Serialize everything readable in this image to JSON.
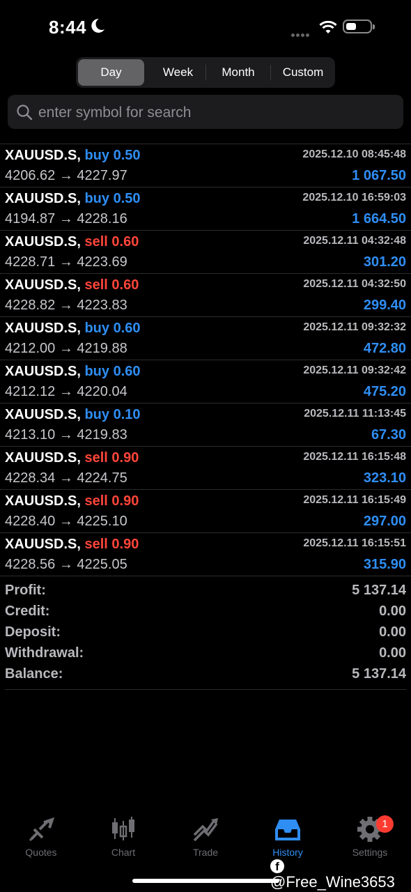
{
  "status": {
    "time": "8:44"
  },
  "period_tabs": [
    {
      "label": "Day",
      "active": true
    },
    {
      "label": "Week",
      "active": false
    },
    {
      "label": "Month",
      "active": false
    },
    {
      "label": "Custom",
      "active": false
    }
  ],
  "search": {
    "placeholder": "enter symbol for search",
    "value": ""
  },
  "deals": [
    {
      "symbol": "XAUUSD.S,",
      "side": "buy",
      "volume": "0.50",
      "datetime": "2025.12.10 08:45:48",
      "open": "4206.62",
      "close": "4227.97",
      "profit": "1 067.50"
    },
    {
      "symbol": "XAUUSD.S,",
      "side": "buy",
      "volume": "0.50",
      "datetime": "2025.12.10 16:59:03",
      "open": "4194.87",
      "close": "4228.16",
      "profit": "1 664.50"
    },
    {
      "symbol": "XAUUSD.S,",
      "side": "sell",
      "volume": "0.60",
      "datetime": "2025.12.11 04:32:48",
      "open": "4228.71",
      "close": "4223.69",
      "profit": "301.20"
    },
    {
      "symbol": "XAUUSD.S,",
      "side": "sell",
      "volume": "0.60",
      "datetime": "2025.12.11 04:32:50",
      "open": "4228.82",
      "close": "4223.83",
      "profit": "299.40"
    },
    {
      "symbol": "XAUUSD.S,",
      "side": "buy",
      "volume": "0.60",
      "datetime": "2025.12.11 09:32:32",
      "open": "4212.00",
      "close": "4219.88",
      "profit": "472.80"
    },
    {
      "symbol": "XAUUSD.S,",
      "side": "buy",
      "volume": "0.60",
      "datetime": "2025.12.11 09:32:42",
      "open": "4212.12",
      "close": "4220.04",
      "profit": "475.20"
    },
    {
      "symbol": "XAUUSD.S,",
      "side": "buy",
      "volume": "0.10",
      "datetime": "2025.12.11 11:13:45",
      "open": "4213.10",
      "close": "4219.83",
      "profit": "67.30"
    },
    {
      "symbol": "XAUUSD.S,",
      "side": "sell",
      "volume": "0.90",
      "datetime": "2025.12.11 16:15:48",
      "open": "4228.34",
      "close": "4224.75",
      "profit": "323.10"
    },
    {
      "symbol": "XAUUSD.S,",
      "side": "sell",
      "volume": "0.90",
      "datetime": "2025.12.11 16:15:49",
      "open": "4228.40",
      "close": "4225.10",
      "profit": "297.00"
    },
    {
      "symbol": "XAUUSD.S,",
      "side": "sell",
      "volume": "0.90",
      "datetime": "2025.12.11 16:15:51",
      "open": "4228.56",
      "close": "4225.05",
      "profit": "315.90"
    }
  ],
  "arrow": "→",
  "summary": [
    {
      "label": "Profit:",
      "value": "5 137.14"
    },
    {
      "label": "Credit:",
      "value": "0.00"
    },
    {
      "label": "Deposit:",
      "value": "0.00"
    },
    {
      "label": "Withdrawal:",
      "value": "0.00"
    },
    {
      "label": "Balance:",
      "value": "5 137.14"
    }
  ],
  "tabbar": [
    {
      "label": "Quotes",
      "icon": "quotes-icon",
      "active": false
    },
    {
      "label": "Chart",
      "icon": "chart-icon",
      "active": false
    },
    {
      "label": "Trade",
      "icon": "trade-icon",
      "active": false
    },
    {
      "label": "History",
      "icon": "history-icon",
      "active": true
    },
    {
      "label": "Settings",
      "icon": "gear-icon",
      "active": false
    }
  ],
  "settings_badge": "1",
  "watermark": "@Free_Wine3653",
  "colors": {
    "buy": "#2f8ef4",
    "sell": "#ff453a",
    "active_tab": "#2f8ef4",
    "badge": "#ff3b30"
  }
}
